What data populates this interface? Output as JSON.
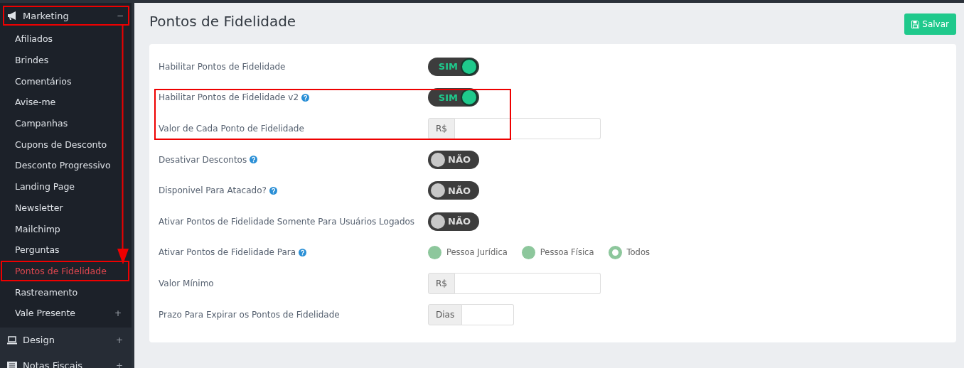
{
  "sidebar": {
    "sections": [
      {
        "label": "Marketing",
        "sign": "−",
        "expanded": true,
        "highlighted": true,
        "items": [
          {
            "label": "Afiliados",
            "selected": false,
            "highlighted": false
          },
          {
            "label": "Brindes",
            "selected": false,
            "highlighted": false
          },
          {
            "label": "Comentários",
            "selected": false,
            "highlighted": false
          },
          {
            "label": "Avise-me",
            "selected": false,
            "highlighted": false
          },
          {
            "label": "Campanhas",
            "selected": false,
            "highlighted": false
          },
          {
            "label": "Cupons de Desconto",
            "selected": false,
            "highlighted": false
          },
          {
            "label": "Desconto Progressivo",
            "selected": false,
            "highlighted": false
          },
          {
            "label": "Landing Page",
            "selected": false,
            "highlighted": false
          },
          {
            "label": "Newsletter",
            "selected": false,
            "highlighted": false
          },
          {
            "label": "Mailchimp",
            "selected": false,
            "highlighted": false
          },
          {
            "label": "Perguntas",
            "selected": false,
            "highlighted": false
          },
          {
            "label": "Pontos de Fidelidade",
            "selected": true,
            "highlighted": true
          },
          {
            "label": "Rastreamento",
            "selected": false,
            "highlighted": false
          },
          {
            "label": "Vale Presente",
            "selected": false,
            "highlighted": false,
            "sign": "+"
          }
        ]
      },
      {
        "label": "Design",
        "sign": "+",
        "expanded": false,
        "highlighted": false
      },
      {
        "label": "Notas Fiscais",
        "sign": "+",
        "expanded": false,
        "highlighted": false
      }
    ]
  },
  "page": {
    "title": "Pontos de Fidelidade",
    "save_button": "Salvar"
  },
  "form": {
    "rows": [
      {
        "kind": "toggle",
        "label": "Habilitar Pontos de Fidelidade",
        "help": false,
        "on": true,
        "state_text": "SIM",
        "highlighted": false
      },
      {
        "kind": "toggle",
        "label": "Habilitar Pontos de Fidelidade v2",
        "help": true,
        "on": true,
        "state_text": "SIM",
        "highlighted": true
      },
      {
        "kind": "input",
        "label": "Valor de Cada Ponto de Fidelidade",
        "help": false,
        "addon": "R$",
        "highlighted": true
      },
      {
        "kind": "toggle",
        "label": "Desativar Descontos",
        "help": true,
        "on": false,
        "state_text": "NÃO",
        "highlighted": false
      },
      {
        "kind": "toggle",
        "label": "Disponivel Para Atacado?",
        "help": true,
        "on": false,
        "state_text": "NÃO",
        "highlighted": false
      },
      {
        "kind": "toggle",
        "label": "Ativar Pontos de Fidelidade Somente Para Usuários Logados",
        "help": false,
        "on": false,
        "state_text": "NÃO",
        "highlighted": false
      },
      {
        "kind": "radio",
        "label": "Ativar Pontos de Fidelidade Para",
        "help": true,
        "highlighted": false,
        "options": [
          {
            "label": "Pessoa Jurídica",
            "selected": false
          },
          {
            "label": "Pessoa Física",
            "selected": false
          },
          {
            "label": "Todos",
            "selected": true
          }
        ]
      },
      {
        "kind": "input",
        "label": "Valor Mínimo",
        "help": false,
        "addon": "R$",
        "highlighted": false
      },
      {
        "kind": "short_input",
        "label": "Prazo Para Expirar os Pontos de Fidelidade",
        "help": false,
        "addon": "Dias",
        "highlighted": false
      }
    ]
  }
}
